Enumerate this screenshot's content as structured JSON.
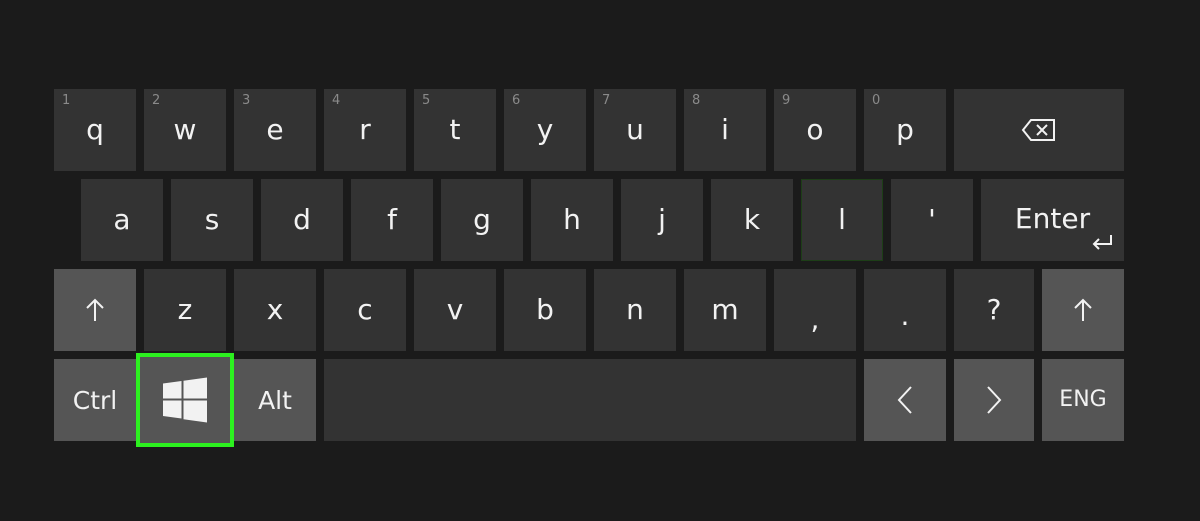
{
  "keyboard": {
    "row1": {
      "q": {
        "num": "1",
        "label": "q"
      },
      "w": {
        "num": "2",
        "label": "w"
      },
      "e": {
        "num": "3",
        "label": "e"
      },
      "r": {
        "num": "4",
        "label": "r"
      },
      "t": {
        "num": "5",
        "label": "t"
      },
      "y": {
        "num": "6",
        "label": "y"
      },
      "u": {
        "num": "7",
        "label": "u"
      },
      "i": {
        "num": "8",
        "label": "i"
      },
      "o": {
        "num": "9",
        "label": "o"
      },
      "p": {
        "num": "0",
        "label": "p"
      },
      "backspace": {
        "icon": "backspace-icon"
      }
    },
    "row2": {
      "a": "a",
      "s": "s",
      "d": "d",
      "f": "f",
      "g": "g",
      "h": "h",
      "j": "j",
      "k": "k",
      "l": "l",
      "apostrophe": "'",
      "enter": {
        "label": "Enter",
        "icon": "enter-arrow-icon"
      }
    },
    "row3": {
      "shift_left": {
        "icon": "shift-arrow-icon"
      },
      "z": "z",
      "x": "x",
      "c": "c",
      "v": "v",
      "b": "b",
      "n": "n",
      "m": "m",
      "comma": ",",
      "period": ".",
      "question": "?",
      "shift_right": {
        "icon": "shift-arrow-icon"
      }
    },
    "row4": {
      "ctrl": "Ctrl",
      "windows": {
        "icon": "windows-logo-icon",
        "selected": true
      },
      "alt": "Alt",
      "space": "",
      "left": {
        "icon": "chevron-left-icon"
      },
      "right": {
        "icon": "chevron-right-icon"
      },
      "lang": "ENG"
    }
  },
  "colors": {
    "background": "#1b1b1b",
    "key_dark": "#333333",
    "key_light": "#555555",
    "selection": "#2cf01f"
  }
}
